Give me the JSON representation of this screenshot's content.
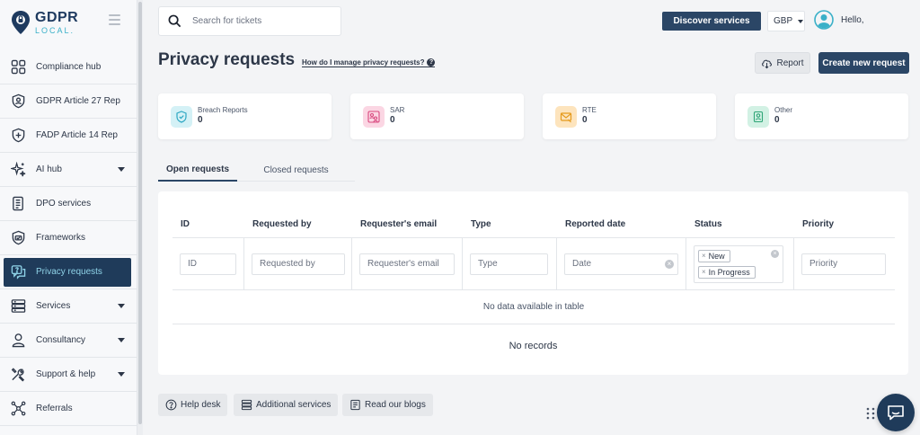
{
  "logo": {
    "line1": "GDPR",
    "line2": "LOCAL."
  },
  "sidebar": {
    "items": [
      {
        "label": "Compliance hub",
        "icon": "grid-icon"
      },
      {
        "label": "GDPR Article 27 Rep",
        "icon": "shield-person-icon"
      },
      {
        "label": "FADP Article 14 Rep",
        "icon": "shield-plus-icon"
      },
      {
        "label": "AI hub",
        "icon": "sparkle-icon",
        "has_caret": true
      },
      {
        "label": "DPO services",
        "icon": "document-icon"
      },
      {
        "label": "Frameworks",
        "icon": "shield-check-icon"
      },
      {
        "label": "Privacy requests",
        "icon": "chat-question-icon",
        "active": true
      },
      {
        "label": "Services",
        "icon": "server-icon",
        "has_caret": true
      },
      {
        "label": "Consultancy",
        "icon": "person-icon",
        "has_caret": true
      },
      {
        "label": "Support & help",
        "icon": "tools-icon",
        "has_caret": true
      },
      {
        "label": "Referrals",
        "icon": "network-icon"
      }
    ]
  },
  "topbar": {
    "search_placeholder": "Search for tickets",
    "discover_label": "Discover services",
    "currency": "GBP",
    "greeting": "Hello,"
  },
  "page": {
    "title": "Privacy requests",
    "help_link": "How do I manage privacy requests?",
    "help_icon": "?",
    "report_label": "Report",
    "create_label": "Create new request"
  },
  "cards": [
    {
      "label": "Breach Reports",
      "value": "0",
      "icon": "shield-check-icon",
      "color": "#d4f1f6",
      "stroke": "#2ba6c2"
    },
    {
      "label": "SAR",
      "value": "0",
      "icon": "people-icon",
      "color": "#fbd6e3",
      "stroke": "#d9497f"
    },
    {
      "label": "RTE",
      "value": "0",
      "icon": "envelope-icon",
      "color": "#fde4bd",
      "stroke": "#e59a1c"
    },
    {
      "label": "Other",
      "value": "0",
      "icon": "badge-icon",
      "color": "#d2f1e4",
      "stroke": "#2fa577"
    }
  ],
  "tabs": {
    "open": "Open requests",
    "closed": "Closed requests"
  },
  "table": {
    "headers": [
      "ID",
      "Requested by",
      "Requester's email",
      "Type",
      "Reported date",
      "Status",
      "Priority"
    ],
    "filters": {
      "id": "ID",
      "requested_by": "Requested by",
      "email": "Requester's email",
      "type": "Type",
      "date": "Date",
      "priority": "Priority"
    },
    "status_chips": [
      "New",
      "In Progress"
    ],
    "no_data": "No data available in table",
    "no_records": "No records"
  },
  "footer": {
    "helpdesk": "Help desk",
    "additional": "Additional services",
    "blogs": "Read our blogs"
  },
  "colors": {
    "primary": "#2b4666",
    "accent": "#3ab0c8"
  }
}
